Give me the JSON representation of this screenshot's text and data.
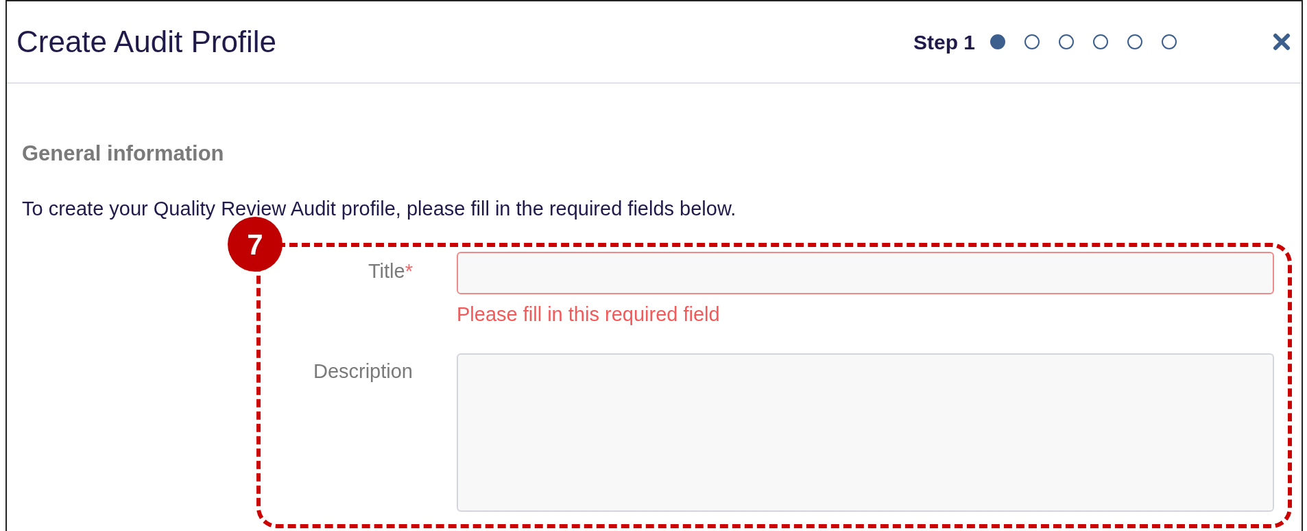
{
  "dialog": {
    "title": "Create Audit Profile",
    "step_label": "Step 1",
    "steps": [
      {
        "selected": true
      },
      {
        "selected": false
      },
      {
        "selected": false
      },
      {
        "selected": false
      },
      {
        "selected": false
      },
      {
        "selected": false
      }
    ]
  },
  "section": {
    "heading": "General information",
    "instructions": "To create your Quality Review Audit profile, please fill in the required fields below."
  },
  "fields": [
    {
      "kind": "input",
      "label": "Title",
      "required_mark": "*",
      "invalid": true,
      "error": "Please fill in this required field"
    },
    {
      "kind": "textarea",
      "label": "Description",
      "invalid": false
    }
  ],
  "annotation": {
    "number": "7"
  }
}
